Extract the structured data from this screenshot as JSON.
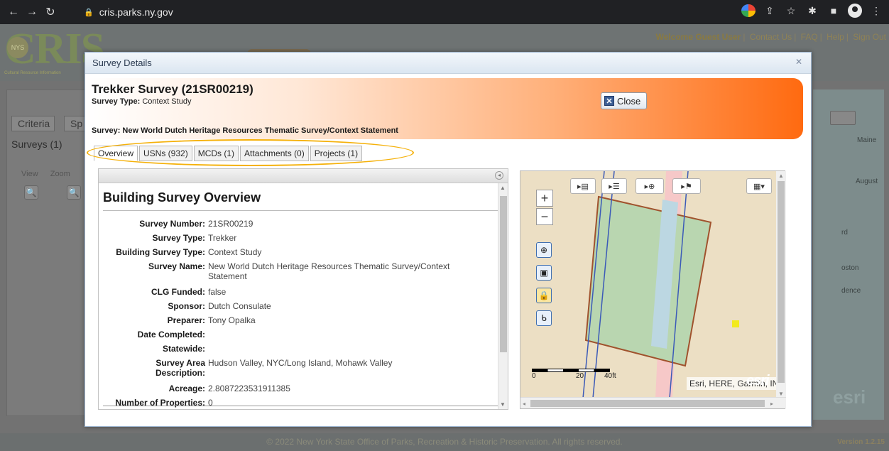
{
  "browser": {
    "url": "cris.parks.ny.gov"
  },
  "app": {
    "logo_text": "CRIS",
    "logo_badge": "NYS",
    "logo_subtitle": "Cultural Resource Information",
    "header_links": {
      "welcome": "Welcome Guest User",
      "contact": "Contact Us",
      "faq": "FAQ",
      "help": "Help",
      "signout": "Sign Out"
    },
    "left_tabs": [
      "Criteria",
      "Sp"
    ],
    "surveys_label": "Surveys (1)",
    "left_columns": [
      "View",
      "Zoom"
    ],
    "bg_map_labels": [
      "Maine",
      "August",
      "rd",
      "oston",
      "dence"
    ],
    "bg_map_esri": "esri",
    "footer": "© 2022 New York State Office of Parks, Recreation & Historic Preservation. All rights reserved.",
    "version": "Version 1.2.15"
  },
  "modal": {
    "title": "Survey Details",
    "survey_title": "Trekker Survey (21SR00219)",
    "survey_type_label": "Survey Type:",
    "survey_type_value": "Context Study",
    "survey_name_line": "Survey: New World Dutch Heritage Resources Thematic Survey/Context Statement",
    "close_label": "Close",
    "tabs": [
      {
        "label": "Overview",
        "active": true
      },
      {
        "label": "USNs (932)",
        "active": false
      },
      {
        "label": "MCDs (1)",
        "active": false
      },
      {
        "label": "Attachments (0)",
        "active": false
      },
      {
        "label": "Projects (1)",
        "active": false
      }
    ],
    "highlight_color": "#f5b10a"
  },
  "overview": {
    "heading": "Building Survey Overview",
    "fields": [
      {
        "label": "Survey Number:",
        "value": "21SR00219"
      },
      {
        "label": "Survey Type:",
        "value": "Trekker"
      },
      {
        "label": "Building Survey Type:",
        "value": "Context Study"
      },
      {
        "label": "Survey Name:",
        "value": "New World Dutch Heritage Resources Thematic Survey/Context",
        "value2": "Statement"
      },
      {
        "label": "CLG Funded:",
        "value": "false"
      },
      {
        "label": "Sponsor:",
        "value": "Dutch Consulate"
      },
      {
        "label": "Preparer:",
        "value": "Tony Opalka"
      },
      {
        "label": "Date Completed:",
        "value": ""
      },
      {
        "label": "Statewide:",
        "value": ""
      },
      {
        "label": "Survey Area",
        "label2": "Description:",
        "value": "Hudson Valley, NYC/Long Island, Mohawk Valley"
      },
      {
        "label": "Acreage:",
        "value": "2.8087223531911385"
      },
      {
        "label": "Number of Properties:",
        "value": "0"
      }
    ]
  },
  "map": {
    "zoom_in": "+",
    "zoom_out": "−",
    "toolbar": [
      "legend-icon",
      "layers-list-icon",
      "add-layer-icon",
      "identify-icon"
    ],
    "basemap_icon": "basemap-gallery-icon",
    "scale_labels": [
      "0",
      "20",
      "40ft"
    ],
    "attribution": "Esri, HERE, Garmin, INCR...",
    "esri_logo": "esri",
    "colors": {
      "land": "#ecdfc4",
      "polygon_fill": "#b9d6b0",
      "polygon_stroke": "#a0522d",
      "river": "#bcd7e2",
      "road": "#f6c8c8",
      "grid_line": "#3b5ab8",
      "marker": "#f2ea1d"
    }
  }
}
